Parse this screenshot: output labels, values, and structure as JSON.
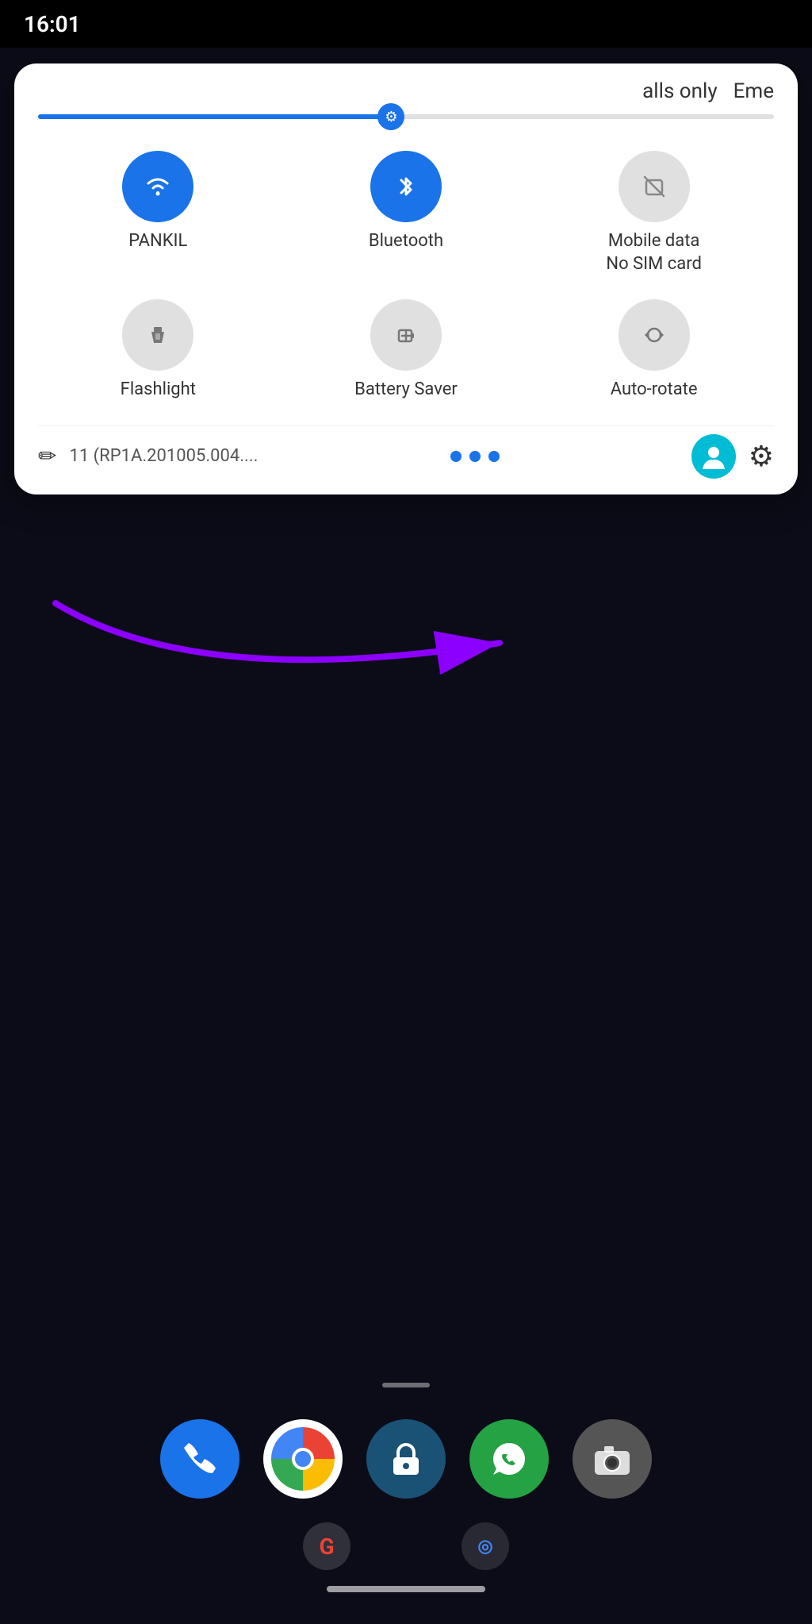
{
  "statusBar": {
    "time": "16:01"
  },
  "panel": {
    "topRight1": "alls only",
    "topRight2": "Eme",
    "tiles": [
      {
        "id": "wifi",
        "label": "PANKIL",
        "active": true,
        "icon": "wifi"
      },
      {
        "id": "bluetooth",
        "label": "Bluetooth",
        "active": true,
        "icon": "bluetooth"
      },
      {
        "id": "mobile-data",
        "label": "Mobile data\nNo SIM card",
        "label1": "Mobile data",
        "label2": "No SIM card",
        "active": false,
        "icon": "sim_card_off"
      },
      {
        "id": "flashlight",
        "label": "Flashlight",
        "active": false,
        "icon": "flashlight"
      },
      {
        "id": "battery-saver",
        "label": "Battery Saver",
        "active": false,
        "icon": "battery_saver"
      },
      {
        "id": "auto-rotate",
        "label": "Auto-rotate",
        "active": false,
        "icon": "screen_rotation"
      }
    ],
    "bottomBuildText": "11 (RP1A.201005.004....",
    "editIconLabel": "✏",
    "settingsIconLabel": "⚙",
    "userIconLabel": "👤"
  },
  "dock": {
    "apps": [
      {
        "id": "phone",
        "label": "Phone"
      },
      {
        "id": "chrome",
        "label": "Chrome"
      },
      {
        "id": "lock",
        "label": "Screen Lock"
      },
      {
        "id": "whatsapp",
        "label": "WhatsApp"
      },
      {
        "id": "camera",
        "label": "Camera"
      }
    ]
  }
}
